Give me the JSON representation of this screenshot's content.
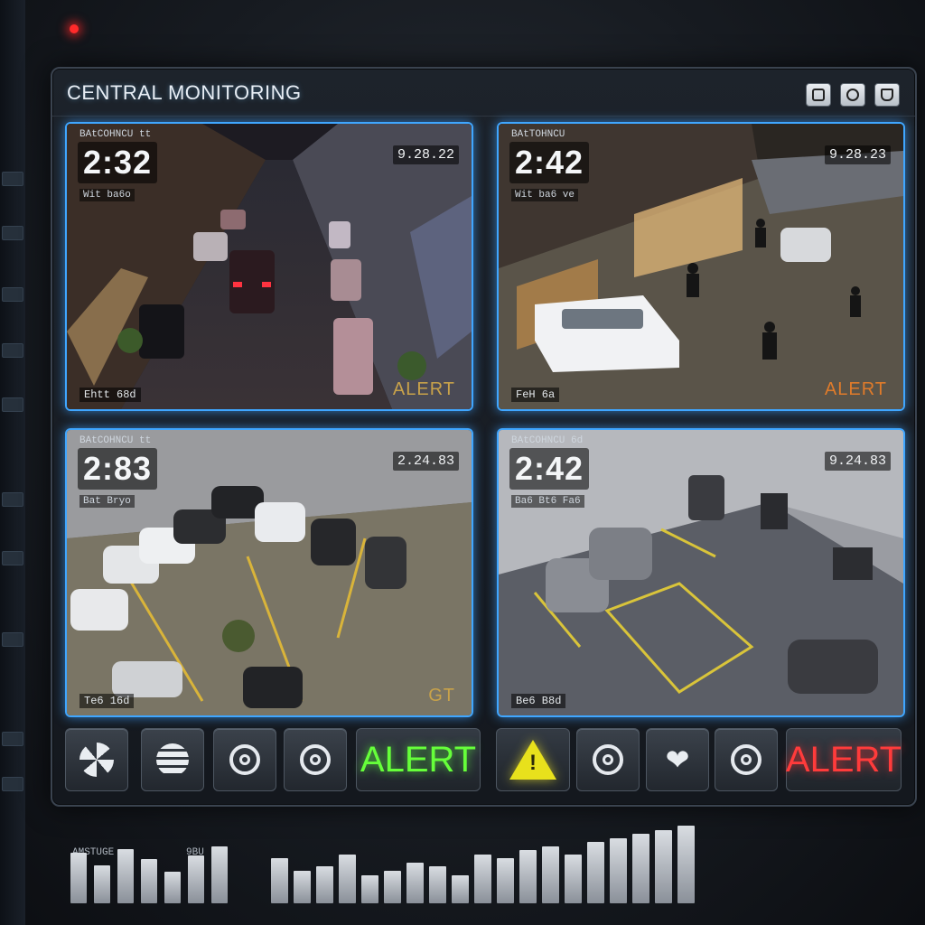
{
  "panel": {
    "title": "CENTRAL MONITORING",
    "header_icons": [
      "square-icon",
      "circle-icon",
      "shield-icon"
    ]
  },
  "cameras": [
    {
      "label": "BAtCOHNCU tt",
      "time": "2:32",
      "sub": "Wit ba6o",
      "date": "9.28.22",
      "footer": "Ehtt 68d",
      "alert": "ALERT",
      "alert_color": "#c8a24a"
    },
    {
      "label": "BAtTOHNCU",
      "time": "2:42",
      "sub": "Wit ba6 ve",
      "date": "9.28.23",
      "footer": "FeH 6a",
      "alert": "ALERT",
      "alert_color": "#e07b2a"
    },
    {
      "label": "BAtCOHNCU tt",
      "time": "2:83",
      "sub": "Bat Bryo",
      "date": "2.24.83",
      "footer": "Te6 16d",
      "alert": "GT",
      "alert_color": "#c8a24a"
    },
    {
      "label": "BAtCOHNCU 6d",
      "time": "2:42",
      "sub": "Ba6 Bt6 Fa6",
      "date": "9.24.83",
      "footer": "Be6 B8d",
      "alert": "",
      "alert_color": "#c8a24a"
    }
  ],
  "controls": {
    "icons": [
      "fan-icon",
      "globe-icon",
      "camera-ring-icon",
      "camera-ring-icon",
      "camera-ring-icon",
      "heart-icon",
      "camera-ring-icon"
    ],
    "alert_left": "ALERT",
    "alert_right": "ALERT",
    "warning_symbol": "!"
  },
  "bottom": {
    "left_label": "AMSTUGE",
    "left_value": "9BU",
    "bars_left": [
      0.8,
      0.6,
      0.85,
      0.7,
      0.5,
      0.75,
      0.9
    ],
    "bars_right": [
      0.55,
      0.4,
      0.45,
      0.6,
      0.35,
      0.4,
      0.5,
      0.45,
      0.35,
      0.6,
      0.55,
      0.65,
      0.7,
      0.6,
      0.75,
      0.8,
      0.85,
      0.9,
      0.95
    ]
  },
  "colors": {
    "accent": "#3fa6ff",
    "alert_green": "#66ff3a",
    "alert_red": "#ff3b3b",
    "warning": "#e8e11c"
  }
}
